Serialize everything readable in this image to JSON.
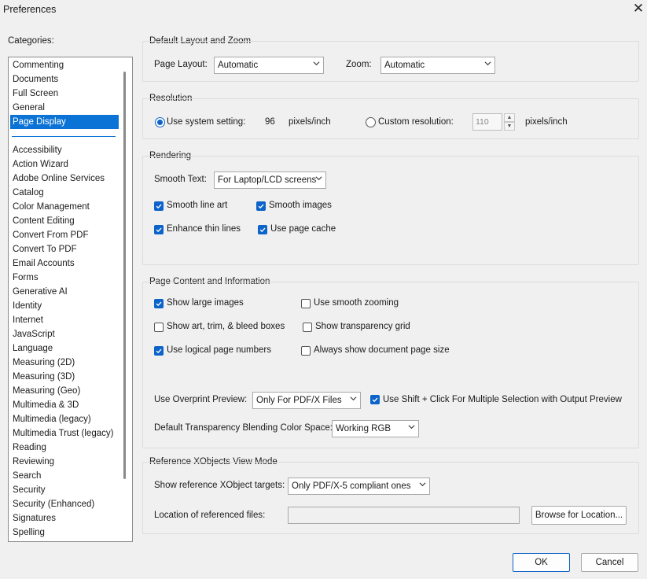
{
  "window": {
    "title": "Preferences",
    "close_glyph": "✕"
  },
  "categories": {
    "label": "Categories:",
    "top_items": [
      "Commenting",
      "Documents",
      "Full Screen",
      "General",
      "Page Display"
    ],
    "selected": "Page Display",
    "items": [
      "Accessibility",
      "Action Wizard",
      "Adobe Online Services",
      "Catalog",
      "Color Management",
      "Content Editing",
      "Convert From PDF",
      "Convert To PDF",
      "Email Accounts",
      "Forms",
      "Generative AI",
      "Identity",
      "Internet",
      "JavaScript",
      "Language",
      "Measuring (2D)",
      "Measuring (3D)",
      "Measuring (Geo)",
      "Multimedia & 3D",
      "Multimedia (legacy)",
      "Multimedia Trust (legacy)",
      "Reading",
      "Reviewing",
      "Search",
      "Security",
      "Security (Enhanced)",
      "Signatures",
      "Spelling"
    ]
  },
  "layout_zoom": {
    "title": "Default Layout and Zoom",
    "page_layout_label": "Page Layout:",
    "page_layout_value": "Automatic",
    "zoom_label": "Zoom:",
    "zoom_value": "Automatic"
  },
  "resolution": {
    "title": "Resolution",
    "system_label": "Use system setting:",
    "system_value": "96",
    "system_unit": "pixels/inch",
    "custom_label": "Custom resolution:",
    "custom_value": "110",
    "custom_unit": "pixels/inch"
  },
  "rendering": {
    "title": "Rendering",
    "smooth_text_label": "Smooth Text:",
    "smooth_text_value": "For Laptop/LCD screens",
    "smooth_line_art": "Smooth line art",
    "smooth_images": "Smooth images",
    "enhance_thin_lines": "Enhance thin lines",
    "use_page_cache": "Use page cache"
  },
  "page_content": {
    "title": "Page Content and Information",
    "show_large_images": "Show large images",
    "use_smooth_zooming": "Use smooth zooming",
    "show_boxes": "Show art, trim, & bleed boxes",
    "show_transparency_grid": "Show transparency grid",
    "use_logical_page_numbers": "Use logical page numbers",
    "always_show_page_size": "Always show document page size",
    "overprint_label": "Use Overprint Preview:",
    "overprint_value": "Only For PDF/X Files",
    "shift_click_label": "Use Shift + Click For Multiple Selection with Output Preview",
    "blending_label": "Default Transparency Blending Color Space:",
    "blending_value": "Working RGB"
  },
  "xobjects": {
    "title": "Reference XObjects View Mode",
    "targets_label": "Show reference XObject targets:",
    "targets_value": "Only PDF/X-5 compliant ones",
    "location_label": "Location of referenced files:",
    "location_value": "",
    "browse_label": "Browse for Location..."
  },
  "footer": {
    "ok_label": "OK",
    "cancel_label": "Cancel"
  },
  "colors": {
    "accent": "#0c63c9",
    "selection": "#0c73d6",
    "background": "#f0f0f0"
  }
}
